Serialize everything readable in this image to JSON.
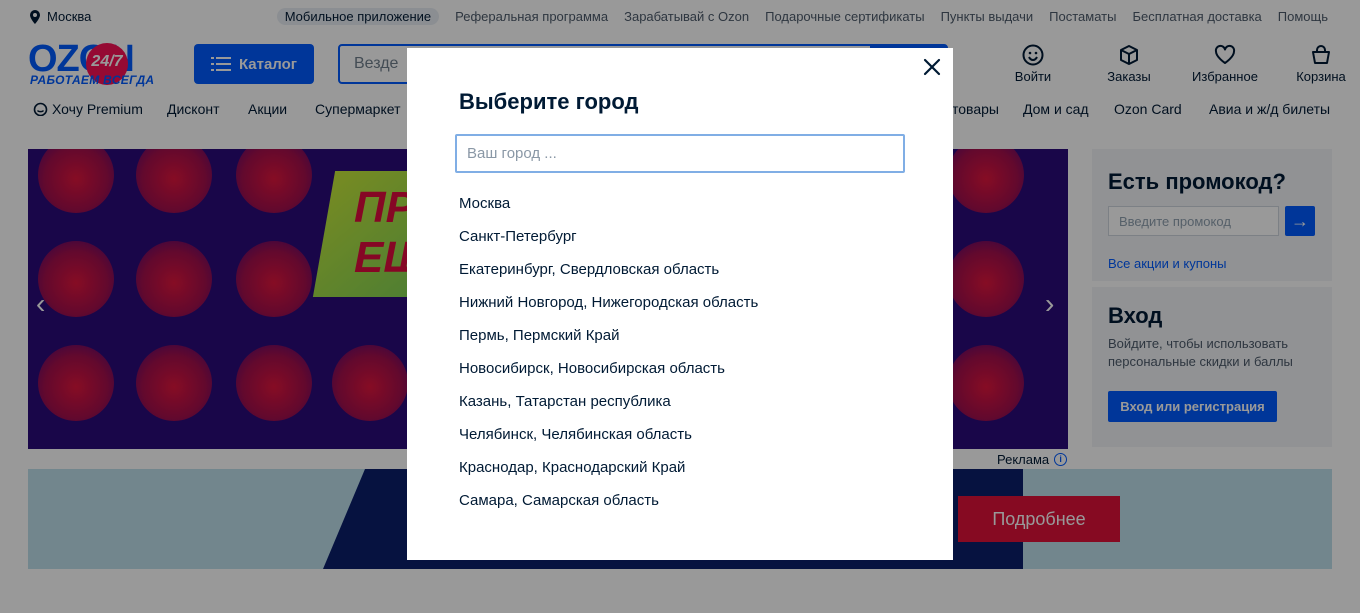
{
  "topbar": {
    "city": "Москва",
    "links": [
      "Мобильное приложение",
      "Реферальная программа",
      "Зарабатывай с Ozon",
      "Подарочные сертификаты",
      "Пункты выдачи",
      "Постаматы",
      "Бесплатная доставка",
      "Помощь"
    ]
  },
  "header": {
    "logo_text": "OZON",
    "logo_badge": "24/7",
    "logo_tagline": "РАБОТАЕМ ВСЕГДА",
    "catalog_label": "Каталог",
    "search_scope": "Везде",
    "icons": [
      {
        "label": "Войти",
        "icon": "smile-icon"
      },
      {
        "label": "Заказы",
        "icon": "box-icon"
      },
      {
        "label": "Избранное",
        "icon": "heart-icon"
      },
      {
        "label": "Корзина",
        "icon": "bag-icon"
      }
    ]
  },
  "nav": {
    "items": [
      "Хочу Premium",
      "Дисконт",
      "Акции",
      "Супермаркет",
      "товары",
      "Дом и сад",
      "Ozon Card",
      "Авиа и ж/д билеты"
    ]
  },
  "banner": {
    "ad_text_line1": "ПР",
    "ad_text_line2": "ЕЩ",
    "ad_label": "Реклама"
  },
  "banner2": {
    "button_label": "Подробнее"
  },
  "promo": {
    "title": "Есть промокод?",
    "placeholder": "Введите промокод",
    "link": "Все акции и купоны"
  },
  "login": {
    "title": "Вход",
    "text": "Войдите, чтобы использовать персональные скидки и баллы",
    "button": "Вход или регистрация"
  },
  "modal": {
    "title": "Выберите город",
    "placeholder": "Ваш город ...",
    "cities": [
      "Москва",
      "Санкт-Петербург",
      "Екатеринбург, Свердловская область",
      "Нижний Новгород, Нижегородская область",
      "Пермь, Пермский Край",
      "Новосибирск, Новосибирская область",
      "Казань, Татарстан республика",
      "Челябинск, Челябинская область",
      "Краснодар, Краснодарский Край",
      "Самара, Самарская область"
    ]
  }
}
